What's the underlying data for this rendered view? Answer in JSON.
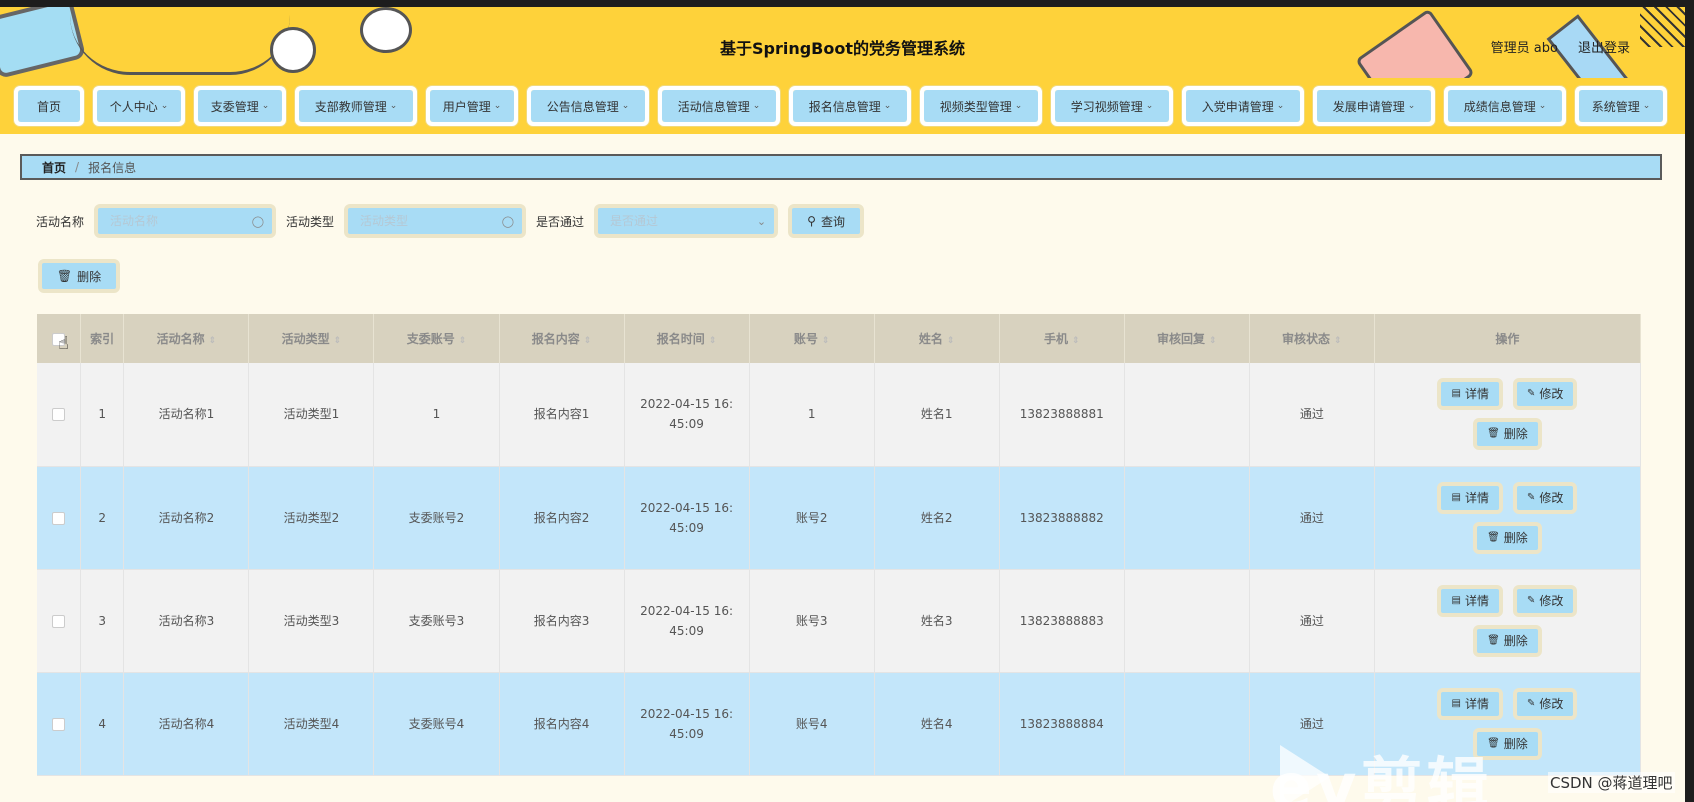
{
  "header": {
    "title": "基于SpringBoot的党务管理系统",
    "user_label": "管理员 abo",
    "logout": "退出登录"
  },
  "nav": [
    {
      "label": "首页",
      "has_dropdown": false,
      "w": 70
    },
    {
      "label": "个人中心",
      "has_dropdown": true,
      "w": 92
    },
    {
      "label": "支委管理",
      "has_dropdown": true,
      "w": 92
    },
    {
      "label": "支部教师管理",
      "has_dropdown": true,
      "w": 122
    },
    {
      "label": "用户管理",
      "has_dropdown": true,
      "w": 92
    },
    {
      "label": "公告信息管理",
      "has_dropdown": true,
      "w": 122
    },
    {
      "label": "活动信息管理",
      "has_dropdown": true,
      "w": 122
    },
    {
      "label": "报名信息管理",
      "has_dropdown": true,
      "w": 122
    },
    {
      "label": "视频类型管理",
      "has_dropdown": true,
      "w": 122
    },
    {
      "label": "学习视频管理",
      "has_dropdown": true,
      "w": 122
    },
    {
      "label": "入党申请管理",
      "has_dropdown": true,
      "w": 122
    },
    {
      "label": "发展申请管理",
      "has_dropdown": true,
      "w": 122
    },
    {
      "label": "成绩信息管理",
      "has_dropdown": true,
      "w": 122
    },
    {
      "label": "系统管理",
      "has_dropdown": true,
      "w": 92
    }
  ],
  "breadcrumb": {
    "home": "首页",
    "sep": "/",
    "current": "报名信息"
  },
  "search": {
    "name_label": "活动名称",
    "name_placeholder": "活动名称",
    "type_label": "活动类型",
    "type_placeholder": "活动类型",
    "passed_label": "是否通过",
    "passed_placeholder": "是否通过",
    "query_button": "查询"
  },
  "delete_button": "删除",
  "table": {
    "columns": [
      "索引",
      "活动名称",
      "活动类型",
      "支委账号",
      "报名内容",
      "报名时间",
      "账号",
      "姓名",
      "手机",
      "审核回复",
      "审核状态",
      "操作"
    ],
    "rows": [
      {
        "index": "1",
        "name": "活动名称1",
        "type": "活动类型1",
        "committee": "1",
        "content": "报名内容1",
        "time": "2022-04-15 16:45:09",
        "account": "1",
        "person": "姓名1",
        "phone": "13823888881",
        "reply": "",
        "status": "通过"
      },
      {
        "index": "2",
        "name": "活动名称2",
        "type": "活动类型2",
        "committee": "支委账号2",
        "content": "报名内容2",
        "time": "2022-04-15 16:45:09",
        "account": "账号2",
        "person": "姓名2",
        "phone": "13823888882",
        "reply": "",
        "status": "通过"
      },
      {
        "index": "3",
        "name": "活动名称3",
        "type": "活动类型3",
        "committee": "支委账号3",
        "content": "报名内容3",
        "time": "2022-04-15 16:45:09",
        "account": "账号3",
        "person": "姓名3",
        "phone": "13823888883",
        "reply": "",
        "status": "通过"
      },
      {
        "index": "4",
        "name": "活动名称4",
        "type": "活动类型4",
        "committee": "支委账号4",
        "content": "报名内容4",
        "time": "2022-04-15 16:45:09",
        "account": "账号4",
        "person": "姓名4",
        "phone": "13823888884",
        "reply": "",
        "status": "通过"
      }
    ],
    "actions": {
      "detail": "详情",
      "edit": "修改",
      "delete": "删除"
    }
  },
  "watermark": {
    "text": "ev剪辑",
    "csdn": "CSDN @蒋道理吧"
  },
  "colors": {
    "header": "#fed23a",
    "button": "#a8dcf5",
    "row_alt": "#c3e6fa",
    "page_bg": "#fefaec"
  }
}
